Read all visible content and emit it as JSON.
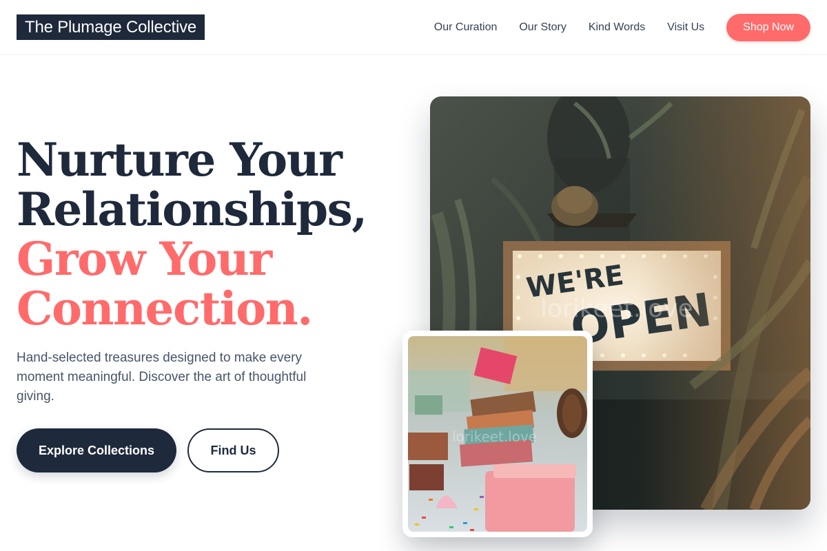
{
  "brand": {
    "name": "The Plumage Collective"
  },
  "nav": {
    "links": [
      "Our Curation",
      "Our Story",
      "Kind Words",
      "Visit Us"
    ],
    "cta": "Shop Now"
  },
  "hero": {
    "headline_dark_1": "Nurture Your",
    "headline_dark_2": "Relationships,",
    "headline_accent_1": "Grow Your",
    "headline_accent_2": "Connection.",
    "subtitle": "Hand-selected treasures designed to make every moment meaningful. Discover the art of thoughtful giving.",
    "primary_button": "Explore Collections",
    "secondary_button": "Find Us"
  },
  "images": {
    "main_sign_text_1": "WE'RE",
    "main_sign_text_2": "OPEN",
    "watermark": "lorikeet.love"
  },
  "colors": {
    "navy": "#1e293b",
    "coral": "#ff6b6b",
    "muted_text": "#475569"
  }
}
